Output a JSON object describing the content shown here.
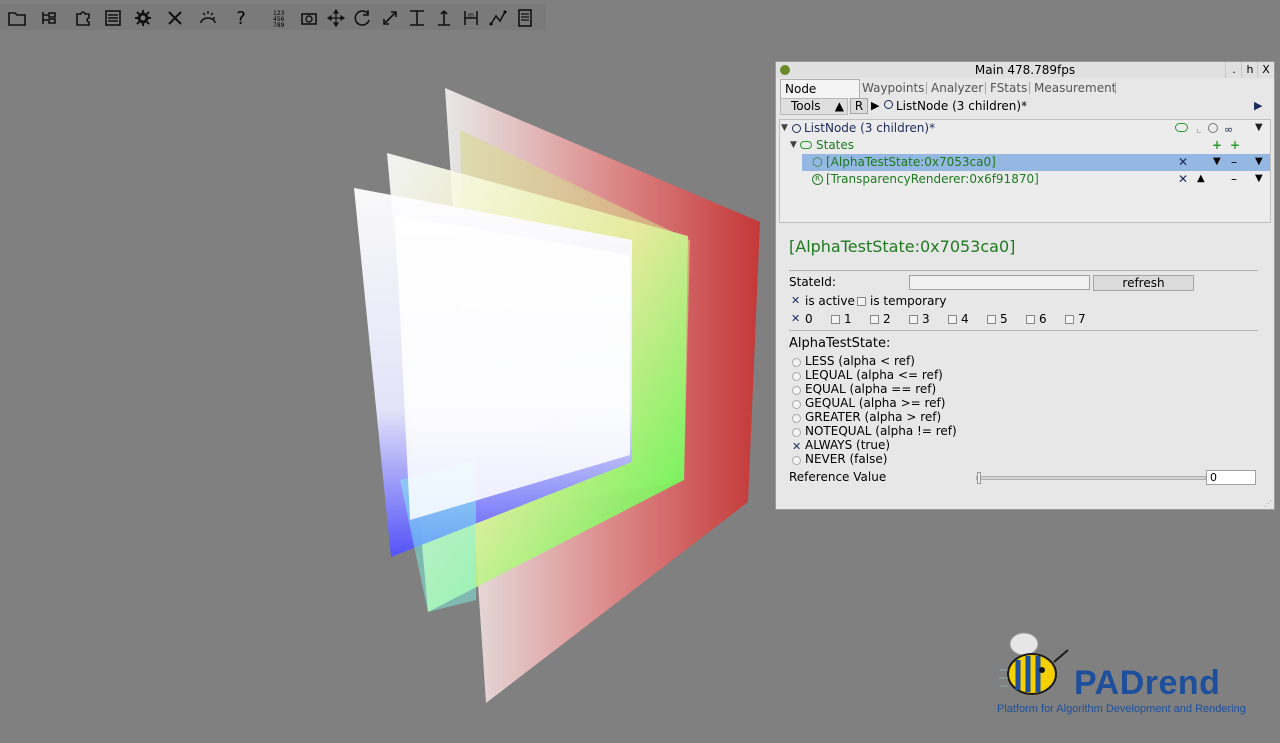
{
  "toolbar": {
    "icons": [
      "folder-icon",
      "scene-tree-icon",
      "puzzle-icon",
      "list-icon",
      "gear-icon",
      "tools-icon",
      "lighting-icon",
      "help-icon",
      "numbers-icon",
      "camera-icon",
      "move-icon",
      "rotate-icon",
      "scale-icon",
      "align-top-icon",
      "anchor-icon",
      "measure-icon",
      "path-icon",
      "notes-icon"
    ],
    "help_label": "?"
  },
  "panel": {
    "title": "Main 478.789fps",
    "window_buttons": [
      ".",
      "h",
      "X"
    ],
    "tabs": [
      "Node Editor",
      "Waypoints",
      "Analyzer",
      "FStats",
      "Measurement"
    ],
    "tools_label": "Tools",
    "r_label": "R",
    "breadcrumb": "ListNode (3 children)*",
    "tree": {
      "root": "ListNode (3 children)*",
      "states": "States",
      "items": [
        {
          "label": "[AlphaTestState:0x7053ca0]",
          "selected": true
        },
        {
          "label": "[TransparencyRenderer:0x6f91870]",
          "selected": false
        }
      ]
    },
    "editor": {
      "heading": "[AlphaTestState:0x7053ca0]",
      "stateid_label": "StateId:",
      "stateid_value": "",
      "refresh_label": "refresh",
      "is_active_label": "is active",
      "is_active": true,
      "is_temporary_label": "is temporary",
      "is_temporary": false,
      "channels": [
        {
          "label": "0",
          "checked": true
        },
        {
          "label": "1",
          "checked": false
        },
        {
          "label": "2",
          "checked": false
        },
        {
          "label": "3",
          "checked": false
        },
        {
          "label": "4",
          "checked": false
        },
        {
          "label": "5",
          "checked": false
        },
        {
          "label": "6",
          "checked": false
        },
        {
          "label": "7",
          "checked": false
        }
      ],
      "section_title": "AlphaTestState:",
      "modes": [
        {
          "label": "LESS (alpha < ref)",
          "selected": false
        },
        {
          "label": "LEQUAL (alpha <= ref)",
          "selected": false
        },
        {
          "label": "EQUAL (alpha == ref)",
          "selected": false
        },
        {
          "label": "GEQUAL (alpha >= ref)",
          "selected": false
        },
        {
          "label": "GREATER (alpha > ref)",
          "selected": false
        },
        {
          "label": "NOTEQUAL (alpha != ref)",
          "selected": false
        },
        {
          "label": "ALWAYS (true)",
          "selected": true
        },
        {
          "label": "NEVER (false)",
          "selected": false
        }
      ],
      "reference_label": "Reference Value",
      "reference_value": "0",
      "slider_fraction": 0
    }
  },
  "logo": {
    "name": "PADrend",
    "tagline": "Platform for Algorithm Development and Rendering"
  },
  "colors": {
    "background": "#808080",
    "accent_green": "#1e7a1e",
    "selection": "#94b8e2",
    "logo_blue": "#1d4f9c",
    "logo_yellow": "#f4d000"
  }
}
